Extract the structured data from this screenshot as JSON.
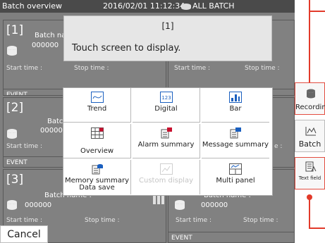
{
  "statusbar": {
    "title": "Batch overview",
    "datetime": "2016/02/01 11:12:34",
    "group": "ALL BATCH"
  },
  "cells": [
    {
      "num": "[1]",
      "batch_name": "Batch na",
      "batch_no": "000000",
      "start": "Start time :",
      "stop": "Stop time :",
      "event": "EVENT"
    },
    {
      "num": "",
      "batch_name": "",
      "batch_no": "",
      "start": "Start time :",
      "stop": "Stop time :",
      "event": "EVENT"
    },
    {
      "num": "[2]",
      "batch_name": "Batch na",
      "batch_no": "000000",
      "start": "Start time :",
      "stop": "",
      "event": "EVENT"
    },
    {
      "num": "",
      "batch_name": "",
      "batch_no": "",
      "start": "",
      "stop": "e :",
      "event": ""
    },
    {
      "num": "[3]",
      "batch_name": "Batch name :",
      "batch_no": "000000",
      "start": "Start time :",
      "stop": "Stop time :",
      "event": ""
    },
    {
      "num": "",
      "batch_name": "Batch name :",
      "batch_no": "000000",
      "start": "Start time :",
      "stop": "Stop time :",
      "event": "EVENT"
    }
  ],
  "popup": {
    "title": "[1]",
    "message": "Touch screen to display."
  },
  "menu": {
    "items": [
      {
        "label": "Trend",
        "icon": "trend-icon"
      },
      {
        "label": "Digital",
        "icon": "digital-icon",
        "icon_text": "123"
      },
      {
        "label": "Bar",
        "icon": "bar-icon"
      },
      {
        "label": "Overview",
        "icon": "overview-icon"
      },
      {
        "label": "Alarm summary",
        "icon": "alarm-summary-icon"
      },
      {
        "label": "Message summary",
        "icon": "message-summary-icon"
      },
      {
        "label": "Memory summary Data save",
        "icon": "memory-summary-icon"
      },
      {
        "label": "Custom display",
        "icon": "custom-display-icon",
        "disabled": true
      },
      {
        "label": "Multi panel",
        "icon": "multi-panel-icon"
      }
    ]
  },
  "cancel_label": "Cancel",
  "side": {
    "recording": "Recording",
    "batch": "Batch",
    "text_field": "Text field"
  },
  "colors": {
    "accent": "#1a5fbf",
    "annotation": "#e23a2a",
    "screen_bg": "#7f7f7f"
  }
}
